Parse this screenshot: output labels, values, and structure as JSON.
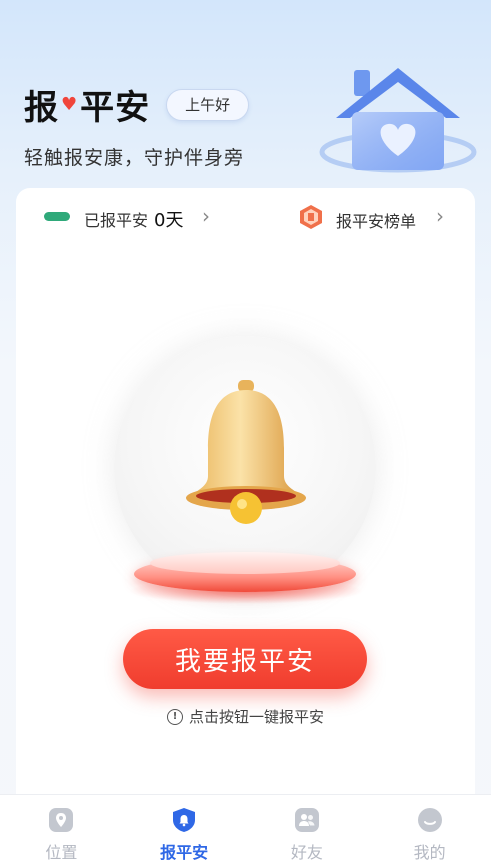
{
  "header": {
    "title_left": "报",
    "title_right": "平安",
    "greeting": "上午好",
    "subtitle": "轻触报安康，守护伴身旁"
  },
  "stats": {
    "reported_label": "已报平安",
    "reported_days": "0天",
    "ranking_label": "报平安榜单"
  },
  "main": {
    "button_label": "我要报平安",
    "hint": "点击按钮一键报平安"
  },
  "tabbar": {
    "items": [
      {
        "label": "位置",
        "icon": "location-pin-icon",
        "active": false
      },
      {
        "label": "报平安",
        "icon": "shield-bell-icon",
        "active": true
      },
      {
        "label": "好友",
        "icon": "friends-icon",
        "active": false
      },
      {
        "label": "我的",
        "icon": "profile-icon",
        "active": false
      }
    ]
  },
  "colors": {
    "accent_red": "#f03d2e",
    "active_blue": "#2f68e6",
    "streak_green": "#2fa97a"
  }
}
